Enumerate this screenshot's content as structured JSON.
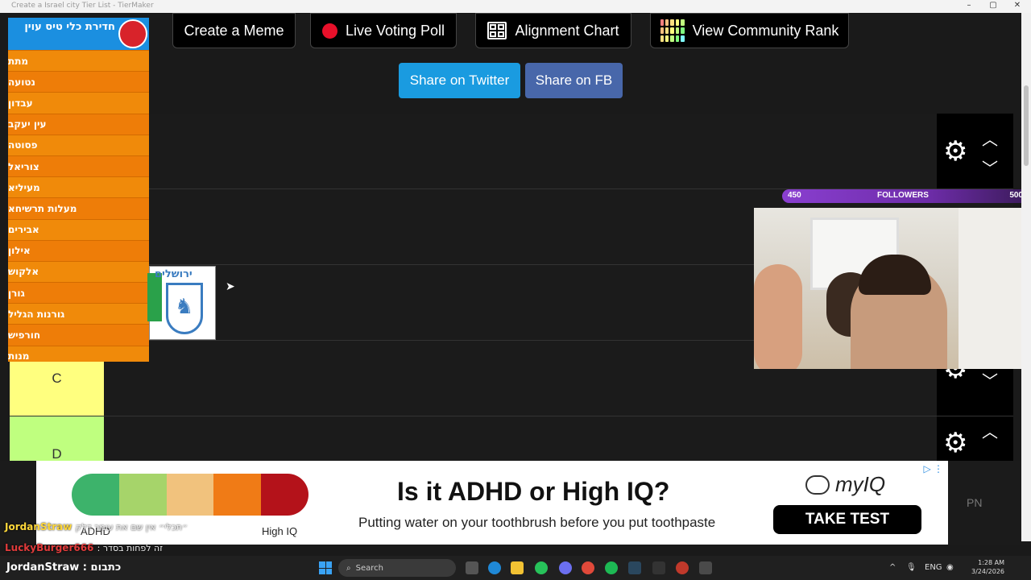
{
  "window": {
    "title": "Create a Israel city Tier List - TierMaker",
    "controls": [
      "–",
      "▢",
      "✕"
    ]
  },
  "toolbar": {
    "create_meme": "Create a Meme",
    "live_voting": "Live Voting Poll",
    "alignment_chart": "Alignment Chart",
    "community_rank": "View Community Rank"
  },
  "share": {
    "twitter": "Share on Twitter",
    "facebook": "Share on FB",
    "twitter_color": "#1a9be0",
    "facebook_color": "#4867aa"
  },
  "tiers": [
    {
      "label": "C",
      "color": "#ffff7f"
    },
    {
      "label": "D",
      "color": "#bfff7f"
    }
  ],
  "dropdown": {
    "title": "חדירת כלי טיס עוין",
    "items": [
      "מתת",
      "נטועה",
      "עבדון",
      "עין יעקב",
      "פסוטה",
      "צוריאל",
      "מעיליא",
      "מעלות תרשיחא",
      "אבירים",
      "אילון",
      "אלקוש",
      "גורן",
      "גורנות הגליל",
      "חורפיש",
      "מנות"
    ]
  },
  "crest": {
    "text": "ירושלים"
  },
  "stream": {
    "followers_label": "FOLLOWERS",
    "followers_current": "450",
    "followers_goal": "500",
    "followers_progress": 0.9
  },
  "ad": {
    "adhd_label": "ADHD",
    "high_iq_label": "High IQ",
    "headline": "Is it ADHD or High IQ?",
    "sub": "Putting water on your toothbrush before you put toothpaste",
    "brand": "myIQ",
    "cta": "TAKE TEST",
    "scale_colors": [
      "#3db36b",
      "#a6d46a",
      "#f1c27d",
      "#f07b16",
      "#b4121a"
    ]
  },
  "right_strip": {
    "text": "PN"
  },
  "chat": {
    "user1": "JordanStraw",
    "msg1": "״תכלי״ אין שם את עומר דלק ",
    "user2": "LuckyBurger666",
    "msg2": " : זה לפחות בסדר"
  },
  "taskbar": {
    "user": "JordanStraw : כתבום",
    "search": "Search",
    "lang": "ENG",
    "time": "1:28 AM",
    "date": "3/24/2026"
  }
}
